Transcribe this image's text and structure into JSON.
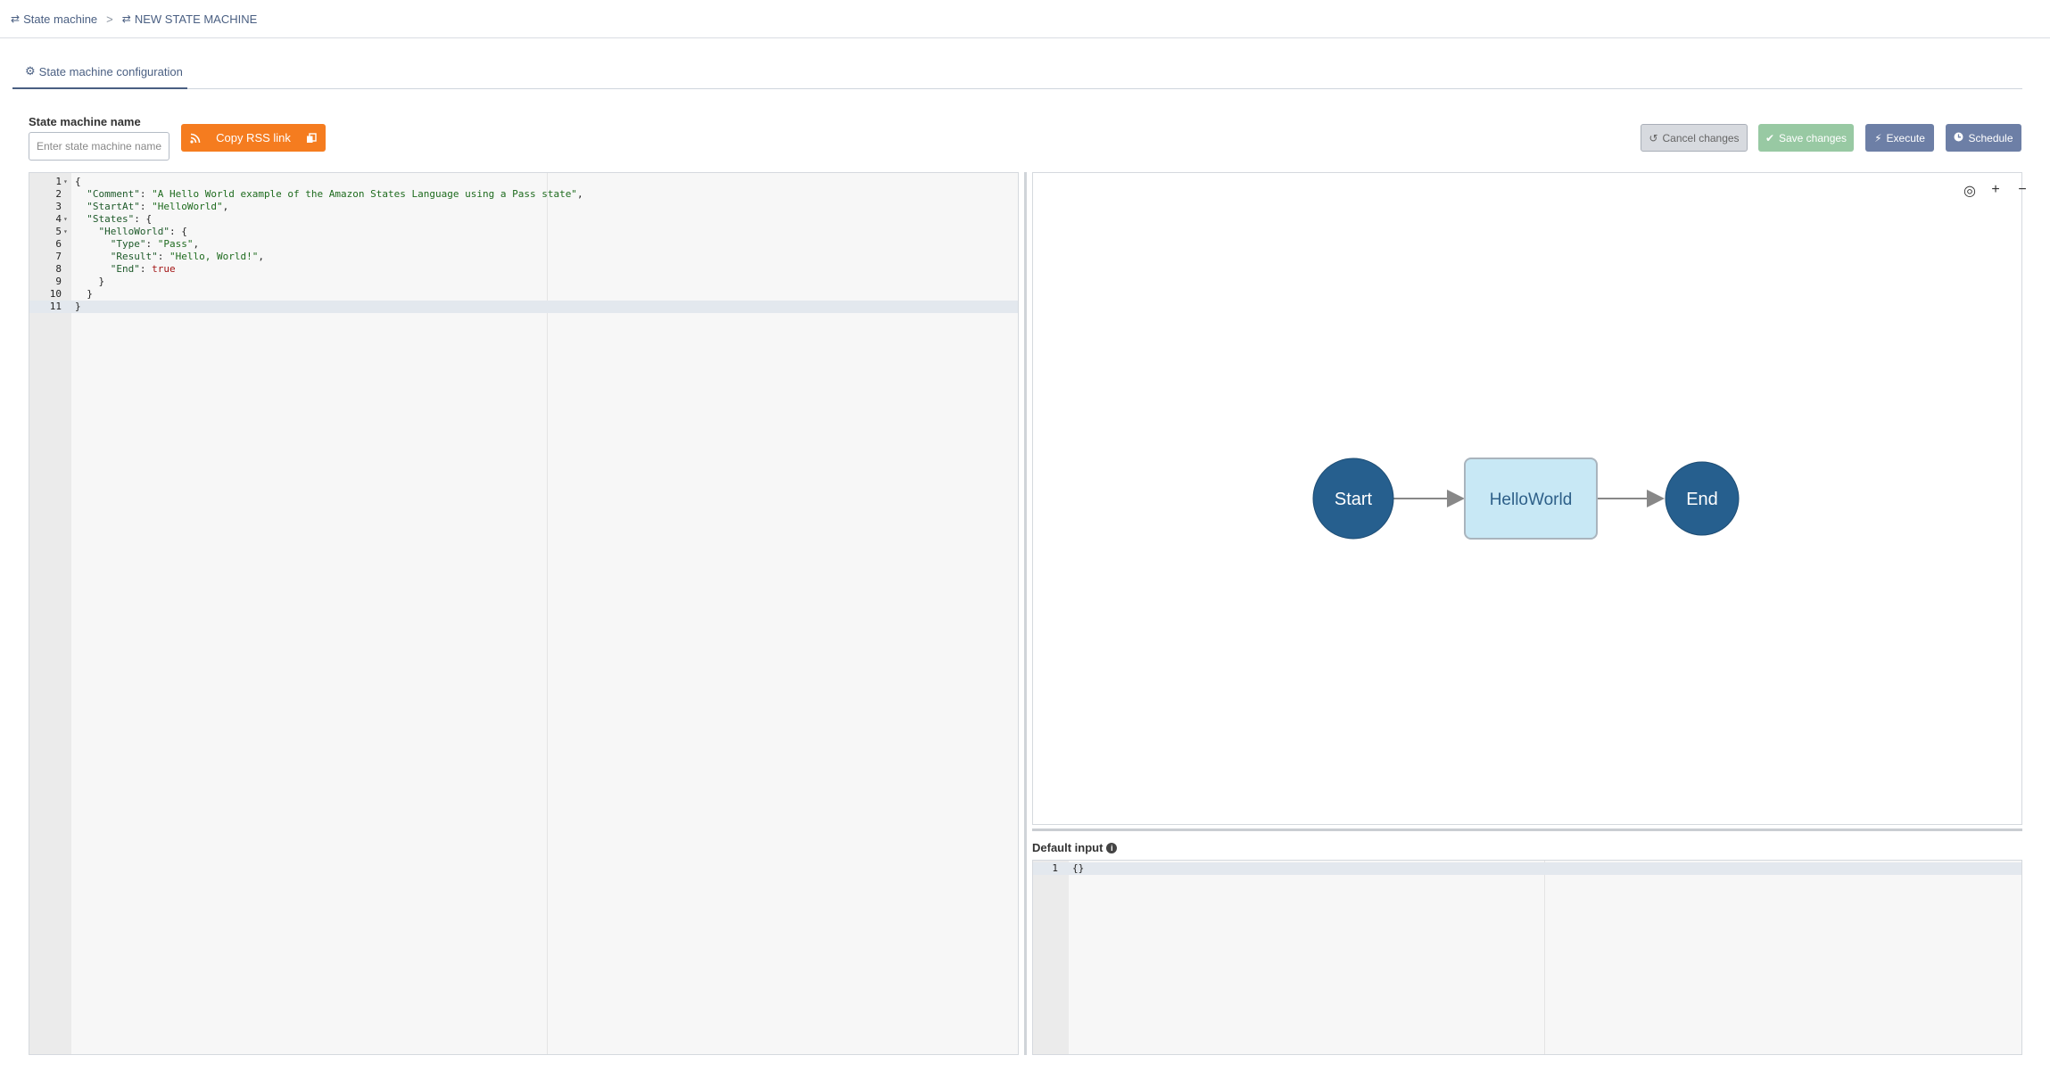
{
  "breadcrumb": {
    "items": [
      {
        "label": "State machine",
        "icon": "refresh-icon"
      },
      {
        "label": "NEW STATE MACHINE",
        "icon": "refresh-icon"
      }
    ],
    "separator": ">"
  },
  "tabs": [
    {
      "label": "State machine configuration",
      "icon": "gear-icon",
      "active": true
    }
  ],
  "form": {
    "name_label": "State machine name",
    "name_placeholder": "Enter state machine name",
    "name_value": ""
  },
  "toolbar": {
    "rss_label": "Copy RSS link",
    "cancel_label": "Cancel changes",
    "save_label": "Save changes",
    "execute_label": "Execute",
    "schedule_label": "Schedule"
  },
  "colors": {
    "accent": "#4a5f82",
    "rss": "#f57c1f",
    "save": "#98c9a3",
    "execute": "#6d7fa6",
    "node_dark": "#265f8e",
    "node_light": "#c8e8f5"
  },
  "code_editor": {
    "lines": [
      {
        "n": "1",
        "fold": true,
        "text": "{"
      },
      {
        "n": "2",
        "fold": false,
        "text": "  \"Comment\": \"A Hello World example of the Amazon States Language using a Pass state\","
      },
      {
        "n": "3",
        "fold": false,
        "text": "  \"StartAt\": \"HelloWorld\","
      },
      {
        "n": "4",
        "fold": true,
        "text": "  \"States\": {"
      },
      {
        "n": "5",
        "fold": true,
        "text": "    \"HelloWorld\": {"
      },
      {
        "n": "6",
        "fold": false,
        "text": "      \"Type\": \"Pass\","
      },
      {
        "n": "7",
        "fold": false,
        "text": "      \"Result\": \"Hello, World!\","
      },
      {
        "n": "8",
        "fold": false,
        "text": "      \"End\": true"
      },
      {
        "n": "9",
        "fold": false,
        "text": "    }"
      },
      {
        "n": "10",
        "fold": false,
        "text": "  }"
      },
      {
        "n": "11",
        "fold": false,
        "text": "}"
      }
    ],
    "active_line": "11"
  },
  "graph": {
    "nodes": [
      {
        "id": "start",
        "label": "Start",
        "shape": "circle"
      },
      {
        "id": "helloworld",
        "label": "HelloWorld",
        "shape": "rect"
      },
      {
        "id": "end",
        "label": "End",
        "shape": "circle"
      }
    ],
    "zoom_controls": [
      {
        "name": "zoom-fit-icon",
        "glyph": "◎"
      },
      {
        "name": "zoom-in-icon",
        "glyph": "+"
      },
      {
        "name": "zoom-out-icon",
        "glyph": "−"
      }
    ]
  },
  "default_input": {
    "label": "Default input",
    "lines": [
      {
        "n": "1",
        "text": "{}"
      }
    ]
  }
}
